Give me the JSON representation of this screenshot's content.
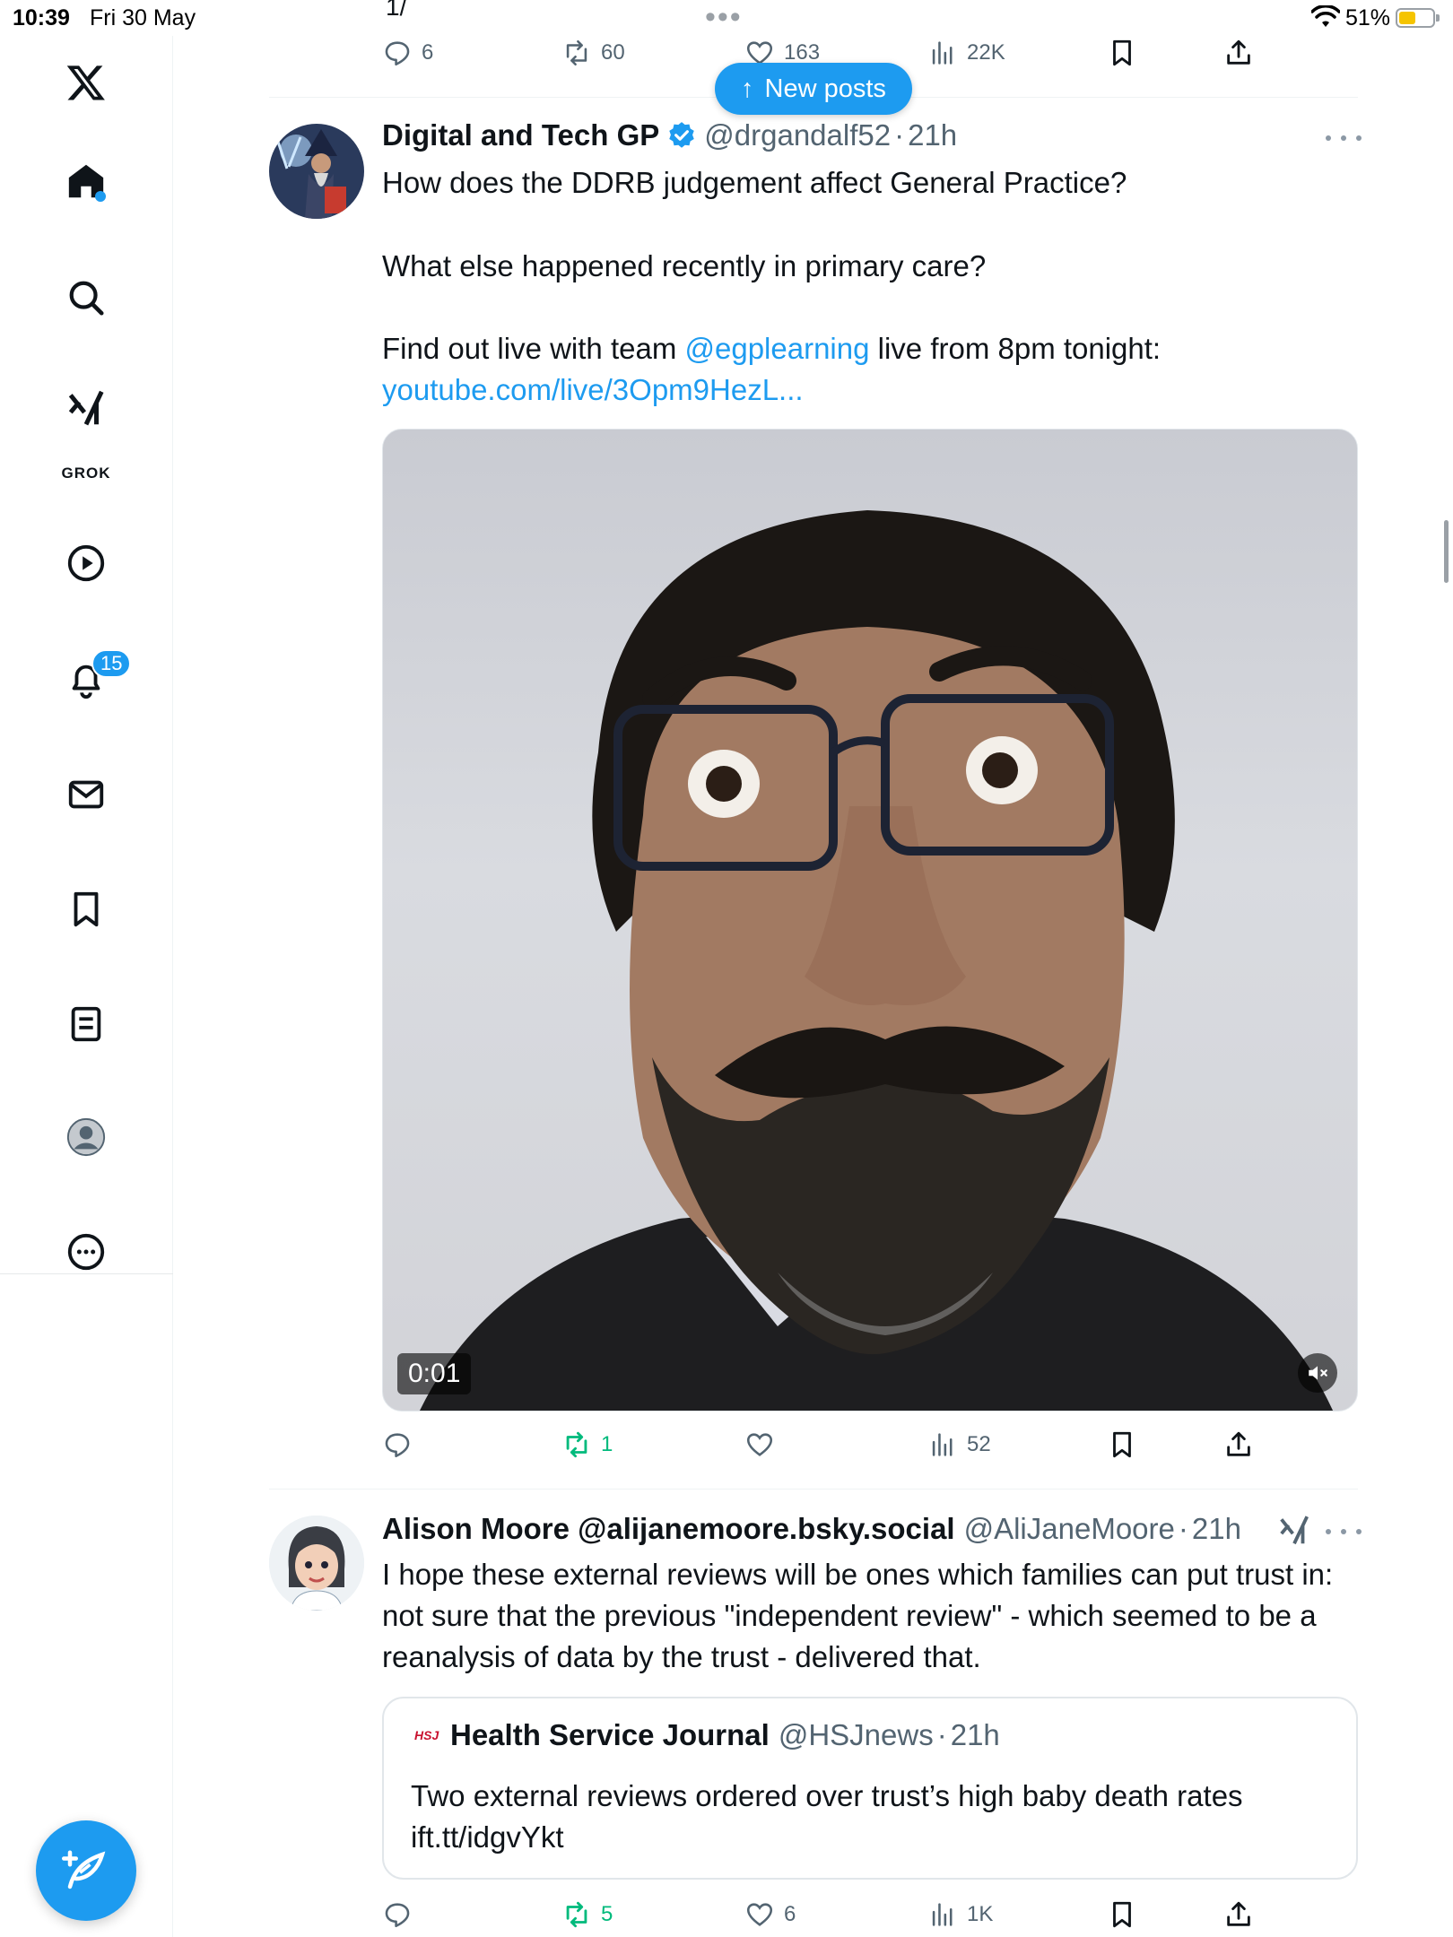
{
  "status_bar": {
    "time": "10:39",
    "date": "Fri 30 May",
    "battery_pct": "51%",
    "battery_level": 0.51
  },
  "nav": {
    "notifications_count": "15",
    "grok_label": "GROK"
  },
  "new_posts_label": "New posts",
  "prev_tweet": {
    "fragment": "1/",
    "replies": "6",
    "reposts": "60",
    "likes": "163",
    "views": "22K"
  },
  "tweet1": {
    "name": "Digital and Tech GP",
    "handle": "@drgandalf52",
    "sep": "·",
    "time": "21h",
    "line1": "How does the DDRB judgement affect General Practice?",
    "line2": "What else happened recently in primary care?",
    "line3_prefix": "Find out live with team ",
    "line3_mention": "@egplearning",
    "line3_suffix": " live from 8pm tonight:",
    "link": "youtube.com/live/3Opm9HezL...",
    "video_time": "0:01",
    "replies": "",
    "reposts": "1",
    "likes": "",
    "views": "52"
  },
  "tweet2": {
    "name": "Alison Moore @alijanemoore.bsky.social",
    "handle": "@AliJaneMoore",
    "sep": "·",
    "time": "21h",
    "text": "I hope these external reviews will be ones which families can put trust in: not sure that the previous \"independent review\" - which seemed to be a reanalysis of data by the trust - delivered that.",
    "quote": {
      "logo": "HSJ",
      "name": "Health Service Journal",
      "handle": "@HSJnews",
      "sep": "·",
      "time": "21h",
      "line1": "Two external reviews ordered over trust’s high baby death rates",
      "line2": "ift.tt/idgvYkt"
    },
    "replies": "",
    "reposts": "5",
    "likes": "6",
    "views": "1K"
  },
  "colors": {
    "accent": "#1d9bf0",
    "repost": "#00ba7c",
    "text": "#0f1419",
    "muted": "#536471"
  }
}
